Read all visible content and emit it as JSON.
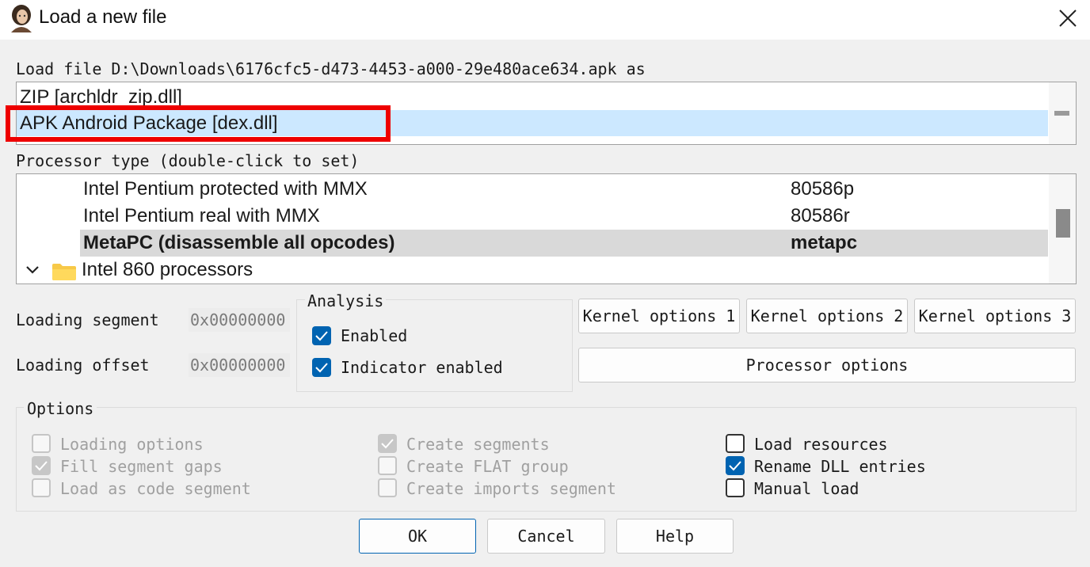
{
  "window": {
    "title": "Load a new file"
  },
  "load_file_label": "Load file D:\\Downloads\\6176cfc5-d473-4453-a000-29e480ace634.apk as",
  "loader_list": {
    "items": [
      {
        "label": "ZIP [archldr_zip.dll]",
        "selected": false
      },
      {
        "label": "APK Android Package [dex.dll]",
        "selected": true
      }
    ]
  },
  "processor_label": "Processor type (double-click to set)",
  "processor_list": {
    "rows": [
      {
        "name": "Intel Pentium protected with MMX",
        "code": "80586p"
      },
      {
        "name": "Intel Pentium real with MMX",
        "code": "80586r"
      },
      {
        "name": "MetaPC (disassemble all opcodes)",
        "code": "metapc",
        "selected": true
      },
      {
        "name": "Intel 860 processors",
        "group": true
      }
    ]
  },
  "loading_segment": {
    "label": "Loading segment",
    "value": "0x00000000"
  },
  "loading_offset": {
    "label": "Loading offset",
    "value": "0x00000000"
  },
  "analysis": {
    "title": "Analysis",
    "enabled": {
      "label": "Enabled",
      "checked": true
    },
    "indicator": {
      "label": "Indicator enabled",
      "checked": true
    }
  },
  "buttons": {
    "kernel1": "Kernel options 1",
    "kernel2": "Kernel options 2",
    "kernel3": "Kernel options 3",
    "processor_options": "Processor options",
    "ok": "OK",
    "cancel": "Cancel",
    "help": "Help"
  },
  "options": {
    "title": "Options",
    "col1": [
      {
        "label": "Loading options",
        "checked": false,
        "disabled": true
      },
      {
        "label": "Fill segment gaps",
        "checked": true,
        "disabled": true
      },
      {
        "label": "Load as code segment",
        "checked": false,
        "disabled": true
      }
    ],
    "col2": [
      {
        "label": "Create segments",
        "checked": true,
        "disabled": true
      },
      {
        "label": "Create FLAT group",
        "checked": false,
        "disabled": true
      },
      {
        "label": "Create imports segment",
        "checked": false,
        "disabled": true
      }
    ],
    "col3": [
      {
        "label": "Load resources",
        "checked": false,
        "disabled": false
      },
      {
        "label": "Rename DLL entries",
        "checked": true,
        "disabled": false
      },
      {
        "label": "Manual load",
        "checked": false,
        "disabled": false
      }
    ]
  },
  "colors": {
    "accent": "#0063b1",
    "selection": "#cce8ff",
    "highlight_annotation": "#ee0000"
  }
}
